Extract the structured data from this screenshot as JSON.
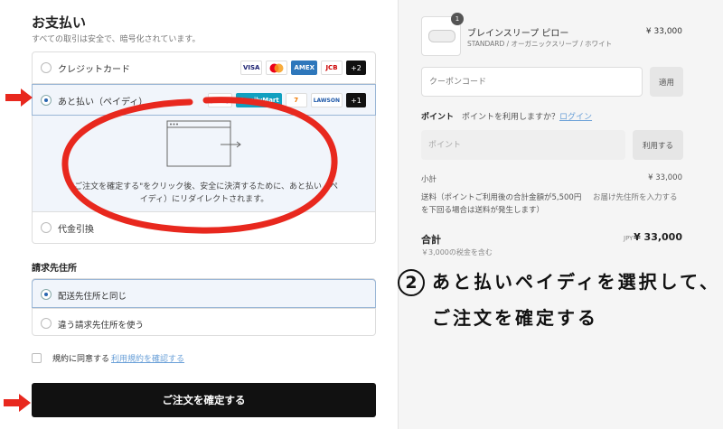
{
  "payment": {
    "title": "お支払い",
    "subtitle": "すべての取引は安全で、暗号化されています。",
    "options": [
      {
        "label": "クレジットカード",
        "selected": false,
        "logos": [
          "VISA",
          "mastercard",
          "AMEX",
          "JCB",
          "+2"
        ]
      },
      {
        "label": "あと払い（ペイディ）",
        "selected": true,
        "logos": [
          "paidy",
          "FamilyMart",
          "7",
          "LAWSON",
          "+1"
        ]
      },
      {
        "label": "代金引換",
        "selected": false
      }
    ],
    "redirect_text": "\"ご注文を確定する\"をクリック後、安全に決済するために、あと払い（ペイディ）にリダイレクトされます。"
  },
  "billing": {
    "title": "請求先住所",
    "options": [
      {
        "label": "配送先住所と同じ",
        "selected": true
      },
      {
        "label": "違う請求先住所を使う",
        "selected": false
      }
    ]
  },
  "terms": {
    "label": "規約に同意する",
    "link": "利用規約を確認する",
    "checked": false
  },
  "order_button": "ご注文を確定する",
  "summary": {
    "product": {
      "name": "ブレインスリープ ピロー",
      "variant": "STANDARD / オーガニックスリーブ / ホワイト",
      "price": "¥ 33,000",
      "quantity": "1"
    },
    "coupon_placeholder": "クーポンコード",
    "apply_label": "適用",
    "point_label": "ポイント",
    "point_question": "ポイントを利用しますか？",
    "login_link": "ログイン",
    "point_placeholder": "ポイント",
    "use_label": "利用する",
    "subtotal_label": "小計",
    "subtotal_value": "¥ 33,000",
    "shipping_label": "送料（ポイントご利用後の合計金額が5,500円を下回る場合は送料が発生します）",
    "shipping_value": "お届け先住所を入力する",
    "total_label": "合計",
    "total_currency": "JPY",
    "total_value": "¥ 33,000",
    "tax_note": "￥3,000の税金を含む"
  },
  "annotation": {
    "number": "2",
    "line1": "あと払いペイディを選択して、",
    "line2": "ご注文を確定する"
  },
  "colors": {
    "accent_red": "#e8281e",
    "link_blue": "#6aa0d8",
    "selected_bg": "#f1f5fb"
  }
}
